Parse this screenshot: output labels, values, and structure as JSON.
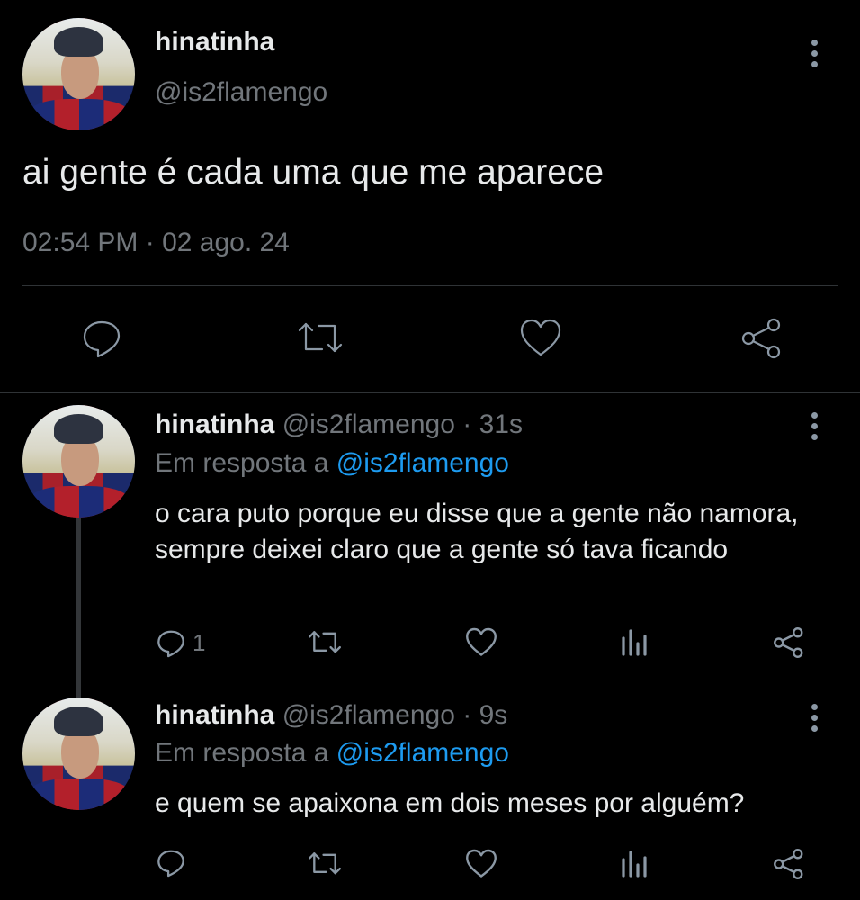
{
  "main_tweet": {
    "name": "hinatinha",
    "handle": "@is2flamengo",
    "text": "ai gente é cada uma que me aparece",
    "timestamp": "02:54 PM · 02 ago. 24",
    "actions": [
      "reply-icon",
      "retweet-icon",
      "like-icon",
      "share-icon"
    ]
  },
  "replies": [
    {
      "name": "hinatinha",
      "handle": "@is2flamengo",
      "time": "· 31s",
      "reply_prefix": "Em resposta a",
      "reply_to": "@is2flamengo",
      "text": "o cara puto porque eu disse que a gente não namora, sempre deixei claro que a gente só tava ficando",
      "reply_count": "1"
    },
    {
      "name": "hinatinha",
      "handle": "@is2flamengo",
      "time": "· 9s",
      "reply_prefix": "Em resposta a",
      "reply_to": "@is2flamengo",
      "text": "e quem se apaixona em dois meses por alguém?",
      "reply_count": ""
    }
  ],
  "colors": {
    "background": "#000000",
    "text": "#e7e9ea",
    "muted": "#71767b",
    "link": "#1d9bf0",
    "divider": "#2f3336"
  }
}
